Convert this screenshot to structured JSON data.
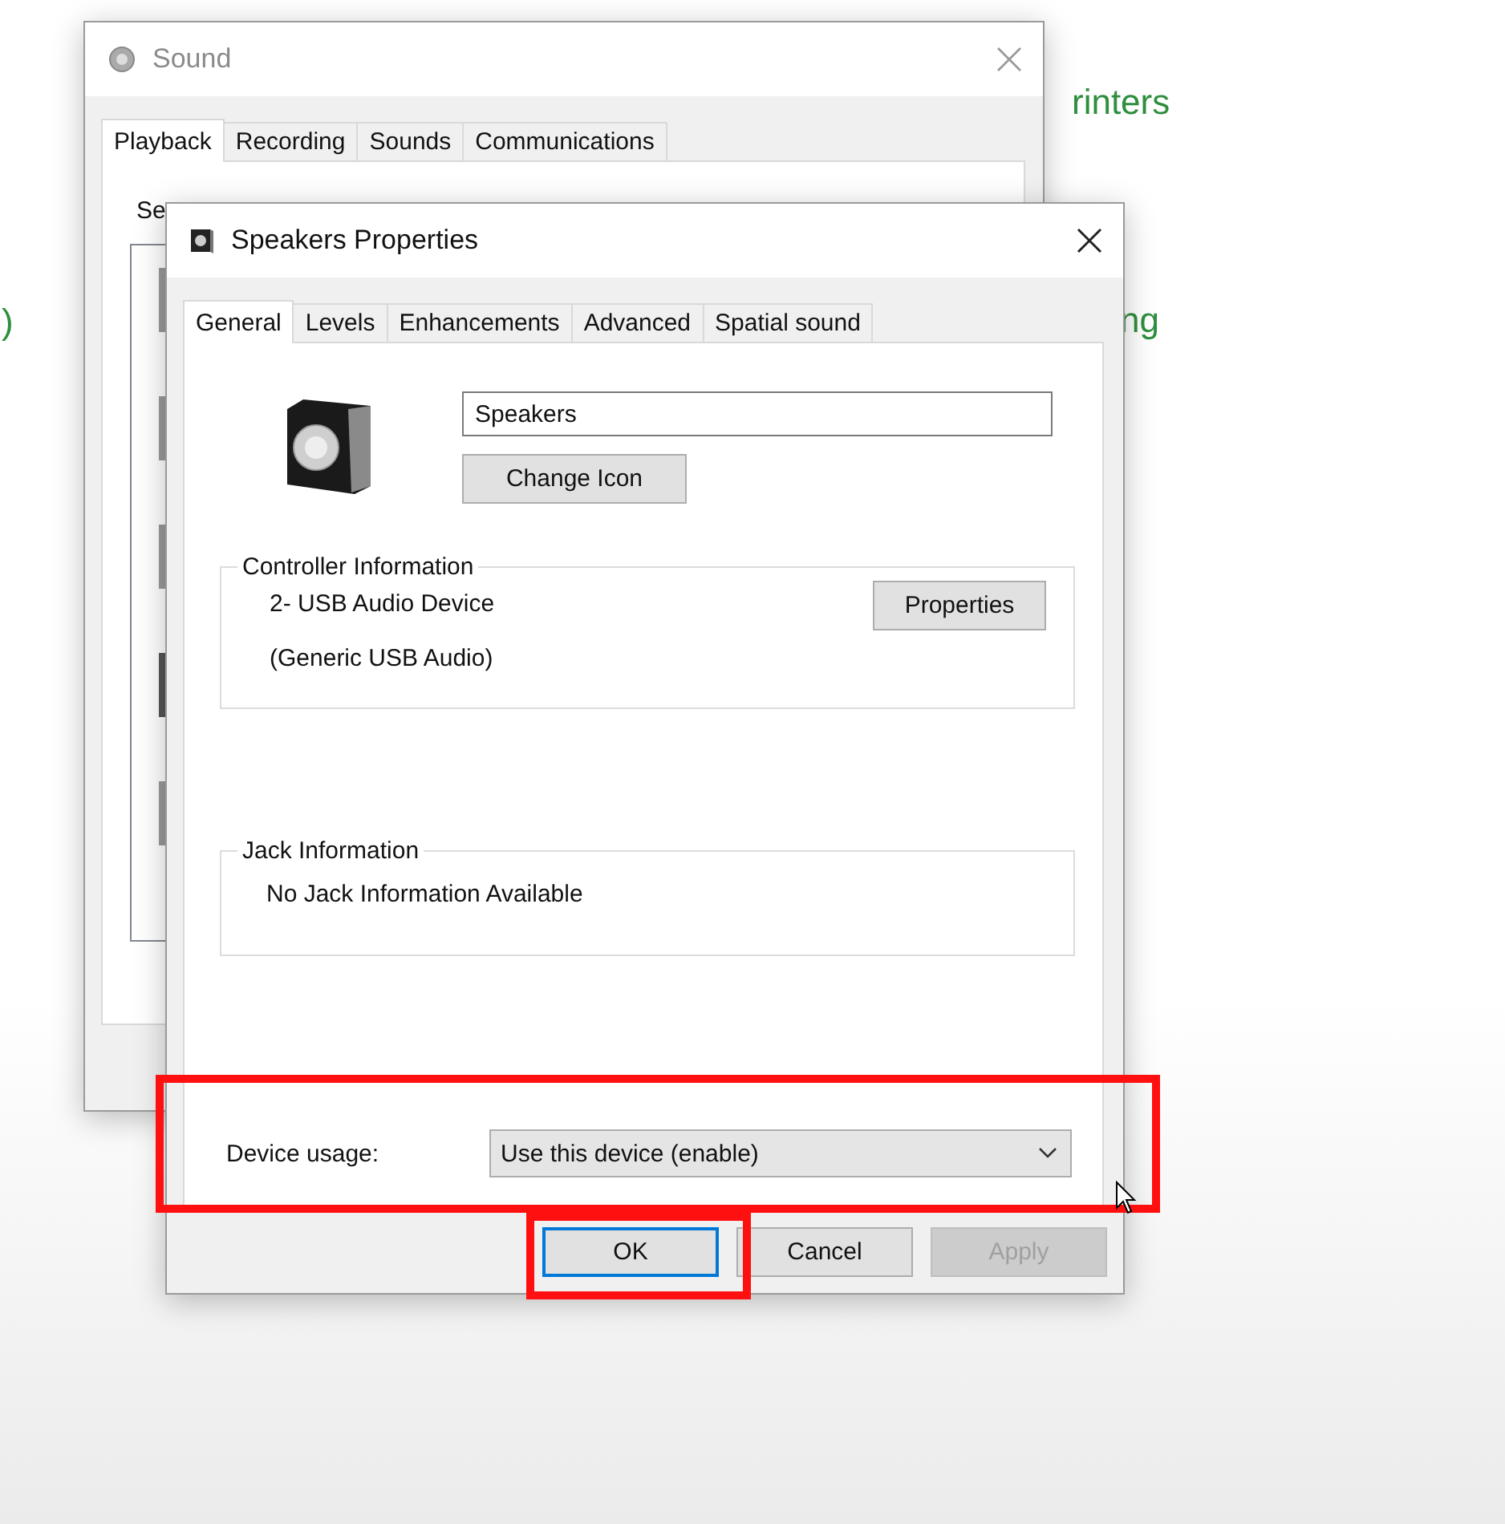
{
  "background_texts": [
    ")",
    "rinters",
    "ng"
  ],
  "sound_window": {
    "title": "Sound",
    "tabs": [
      {
        "label": "Playback",
        "selected": true
      },
      {
        "label": "Recording",
        "selected": false
      },
      {
        "label": "Sounds",
        "selected": false
      },
      {
        "label": "Communications",
        "selected": false
      }
    ],
    "instruction": "Se"
  },
  "properties_window": {
    "title": "Speakers Properties",
    "tabs": [
      {
        "label": "General",
        "selected": true
      },
      {
        "label": "Levels",
        "selected": false
      },
      {
        "label": "Enhancements",
        "selected": false
      },
      {
        "label": "Advanced",
        "selected": false
      },
      {
        "label": "Spatial sound",
        "selected": false
      }
    ],
    "device_name": "Speakers",
    "change_icon_button": "Change Icon",
    "controller_group": {
      "title": "Controller Information",
      "lines": [
        "2- USB Audio Device",
        "(Generic USB Audio)"
      ],
      "button": "Properties"
    },
    "jack_group": {
      "title": "Jack Information",
      "text": "No Jack Information Available"
    },
    "device_usage": {
      "label": "Device usage:",
      "value": "Use this device (enable)"
    },
    "buttons": [
      {
        "label": "OK",
        "focused": true,
        "disabled": false
      },
      {
        "label": "Cancel",
        "focused": false,
        "disabled": false
      },
      {
        "label": "Apply",
        "focused": false,
        "disabled": true
      }
    ]
  }
}
